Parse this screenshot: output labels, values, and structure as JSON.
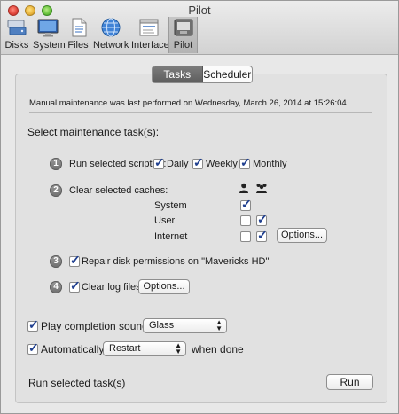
{
  "window": {
    "title": "Pilot"
  },
  "toolbar": {
    "items": [
      {
        "label": "Disks",
        "icon": "disks-icon"
      },
      {
        "label": "System",
        "icon": "system-icon"
      },
      {
        "label": "Files",
        "icon": "files-icon"
      },
      {
        "label": "Network",
        "icon": "network-icon"
      },
      {
        "label": "Interface",
        "icon": "interface-icon"
      },
      {
        "label": "Pilot",
        "icon": "pilot-icon",
        "selected": true
      }
    ]
  },
  "tabs": [
    {
      "label": "Tasks",
      "selected": true
    },
    {
      "label": "Scheduler",
      "selected": false
    }
  ],
  "tasks": {
    "status_text": "Manual maintenance was last performed on Wednesday, March 26, 2014 at 15:26:04.",
    "section_title": "Select maintenance task(s):",
    "task1": {
      "number": "1",
      "label": "Run selected script(s):",
      "daily": {
        "label": "Daily",
        "checked": true
      },
      "weekly": {
        "label": "Weekly",
        "checked": true
      },
      "monthly": {
        "label": "Monthly",
        "checked": true
      }
    },
    "task2": {
      "number": "2",
      "label": "Clear selected caches:",
      "user_icon": "single-user-icon",
      "all_users_icon": "multiple-users-icon",
      "system": {
        "label": "System",
        "checked": true
      },
      "user": {
        "label": "User",
        "single_checked": false,
        "all_checked": true
      },
      "internet": {
        "label": "Internet",
        "single_checked": false,
        "all_checked": true
      },
      "options_label": "Options..."
    },
    "task3": {
      "number": "3",
      "label": "Repair disk permissions on \"Mavericks HD\"",
      "checked": true
    },
    "task4": {
      "number": "4",
      "label": "Clear log files",
      "checked": true,
      "options_label": "Options..."
    },
    "sound": {
      "label": "Play completion sound:",
      "checked": true,
      "value": "Glass"
    },
    "auto": {
      "label": "Automatically",
      "checked": true,
      "value": "Restart",
      "suffix": "when done"
    },
    "run_text": "Run selected task(s)",
    "run_button": "Run"
  },
  "colors": {
    "accent_check": "#1f3f8f",
    "selected_tab": "#6b6b6b"
  }
}
